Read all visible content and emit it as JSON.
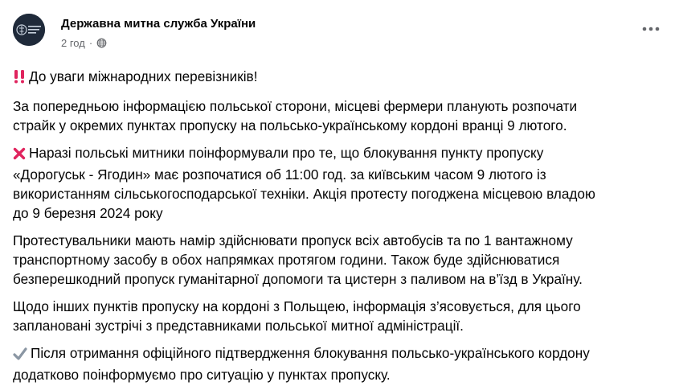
{
  "header": {
    "page_name": "Державна митна служба України",
    "time": "2 год",
    "separator": "·",
    "avatar_caption": "Державна митна служба України"
  },
  "icons": {
    "privacy": "globe-icon",
    "menu": "more-horizontal-icon",
    "p1": "double-exclamation-icon",
    "p3": "cross-mark-icon",
    "p6": "check-mark-icon"
  },
  "colors": {
    "accent_red": "#e0245e",
    "meta_gray": "#65676b",
    "avatar_bg": "#1f2a3a"
  },
  "post": {
    "p1": "До уваги міжнародних перевізників!",
    "p2_l1": "За попередньою інформацією польської сторони, місцеві фермери планують розпочати",
    "p2_l2": "страйк у окремих пунктах пропуску на польсько-українському кордоні вранці 9 лютого.",
    "p3_l1": "Наразі польські митники поінформували про те, що блокування пункту пропуску",
    "p3_l2": "«Дорогуськ - Ягодин» має розпочатися об 11:00 год. за київським часом 9 лютого із",
    "p3_l3": "використанням сільськогосподарської техніки. Акція протесту погоджена місцевою владою",
    "p3_l4": "до 9 березня 2024 року",
    "p4_l1": "Протестувальники мають намір здійснювати пропуск всіх автобусів та по 1 вантажному",
    "p4_l2": "транспортному засобу в обох напрямках протягом години. Також буде здійснюватися",
    "p4_l3": "безперешкодний пропуск гуманітарної допомоги та цистерн з паливом на в’їзд в Україну.",
    "p5_l1": "Щодо інших пунктів пропуску на кордоні з Польщею, інформація з’ясовується, для цього",
    "p5_l2": "заплановані зустрічі з представниками польської митної адміністрації.",
    "p6_l1": "Після отримання офіційного підтвердження блокування польсько-українського кордону",
    "p6_l2": "додатково поінформуємо про ситуацію у пунктах пропуску."
  }
}
